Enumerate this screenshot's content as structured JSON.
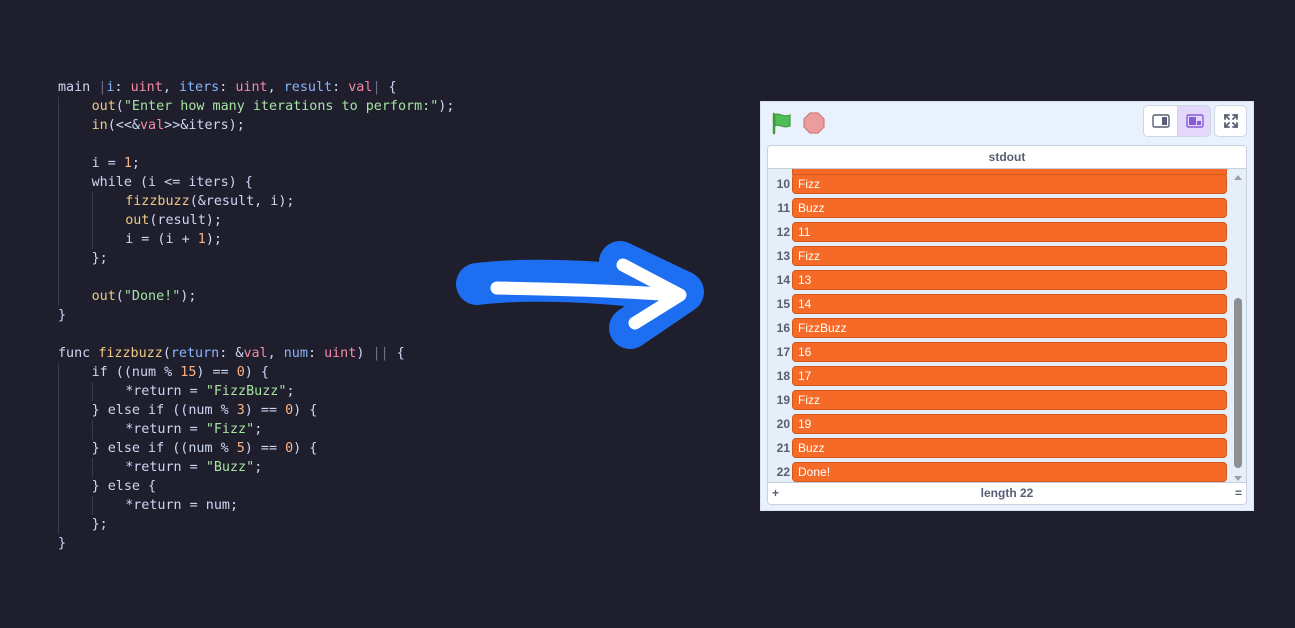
{
  "code": {
    "lines": [
      [
        {
          "t": "main ",
          "c": "kw"
        },
        {
          "t": "|",
          "c": "bar"
        },
        {
          "t": "i",
          "c": "id"
        },
        {
          "t": ": ",
          "c": "kw"
        },
        {
          "t": "uint",
          "c": "ty"
        },
        {
          "t": ", ",
          "c": "kw"
        },
        {
          "t": "iters",
          "c": "id"
        },
        {
          "t": ": ",
          "c": "kw"
        },
        {
          "t": "uint",
          "c": "ty"
        },
        {
          "t": ", ",
          "c": "kw"
        },
        {
          "t": "result",
          "c": "id"
        },
        {
          "t": ": ",
          "c": "kw"
        },
        {
          "t": "val",
          "c": "ty"
        },
        {
          "t": "|",
          "c": "bar"
        },
        {
          "t": " {",
          "c": "kw"
        }
      ],
      [
        {
          "i": 1
        },
        {
          "t": "out",
          "c": "fn"
        },
        {
          "t": "(",
          "c": "kw"
        },
        {
          "t": "\"Enter how many iterations to perform:\"",
          "c": "str"
        },
        {
          "t": ");",
          "c": "kw"
        }
      ],
      [
        {
          "i": 1
        },
        {
          "t": "in",
          "c": "fn"
        },
        {
          "t": "(<<&",
          "c": "kw"
        },
        {
          "t": "val",
          "c": "ty"
        },
        {
          "t": ">>&iters);",
          "c": "kw"
        }
      ],
      [
        {
          "i": 1
        }
      ],
      [
        {
          "i": 1
        },
        {
          "t": "i = ",
          "c": "kw"
        },
        {
          "t": "1",
          "c": "num"
        },
        {
          "t": ";",
          "c": "kw"
        }
      ],
      [
        {
          "i": 1
        },
        {
          "t": "while (i <= iters) {",
          "c": "kw"
        }
      ],
      [
        {
          "i": 2
        },
        {
          "t": "fizzbuzz",
          "c": "fn"
        },
        {
          "t": "(&result, i);",
          "c": "kw"
        }
      ],
      [
        {
          "i": 2
        },
        {
          "t": "out",
          "c": "fn"
        },
        {
          "t": "(result);",
          "c": "kw"
        }
      ],
      [
        {
          "i": 2
        },
        {
          "t": "i = (i + ",
          "c": "kw"
        },
        {
          "t": "1",
          "c": "num"
        },
        {
          "t": ");",
          "c": "kw"
        }
      ],
      [
        {
          "i": 1
        },
        {
          "t": "};",
          "c": "kw"
        }
      ],
      [
        {
          "i": 1
        }
      ],
      [
        {
          "i": 1
        },
        {
          "t": "out",
          "c": "fn"
        },
        {
          "t": "(",
          "c": "kw"
        },
        {
          "t": "\"Done!\"",
          "c": "str"
        },
        {
          "t": ");",
          "c": "kw"
        }
      ],
      [
        {
          "t": "}",
          "c": "kw"
        }
      ],
      [],
      [
        {
          "t": "func ",
          "c": "kw"
        },
        {
          "t": "fizzbuzz",
          "c": "fn"
        },
        {
          "t": "(",
          "c": "kw"
        },
        {
          "t": "return",
          "c": "id"
        },
        {
          "t": ": &",
          "c": "kw"
        },
        {
          "t": "val",
          "c": "ty"
        },
        {
          "t": ", ",
          "c": "kw"
        },
        {
          "t": "num",
          "c": "id"
        },
        {
          "t": ": ",
          "c": "kw"
        },
        {
          "t": "uint",
          "c": "ty"
        },
        {
          "t": ") ",
          "c": "kw"
        },
        {
          "t": "||",
          "c": "bar"
        },
        {
          "t": " {",
          "c": "kw"
        }
      ],
      [
        {
          "i": 1
        },
        {
          "t": "if ((num % ",
          "c": "kw"
        },
        {
          "t": "15",
          "c": "num"
        },
        {
          "t": ") == ",
          "c": "kw"
        },
        {
          "t": "0",
          "c": "num"
        },
        {
          "t": ") {",
          "c": "kw"
        }
      ],
      [
        {
          "i": 2
        },
        {
          "t": "*return = ",
          "c": "kw"
        },
        {
          "t": "\"FizzBuzz\"",
          "c": "str"
        },
        {
          "t": ";",
          "c": "kw"
        }
      ],
      [
        {
          "i": 1
        },
        {
          "t": "} else if ((num % ",
          "c": "kw"
        },
        {
          "t": "3",
          "c": "num"
        },
        {
          "t": ") == ",
          "c": "kw"
        },
        {
          "t": "0",
          "c": "num"
        },
        {
          "t": ") {",
          "c": "kw"
        }
      ],
      [
        {
          "i": 2
        },
        {
          "t": "*return = ",
          "c": "kw"
        },
        {
          "t": "\"Fizz\"",
          "c": "str"
        },
        {
          "t": ";",
          "c": "kw"
        }
      ],
      [
        {
          "i": 1
        },
        {
          "t": "} else if ((num % ",
          "c": "kw"
        },
        {
          "t": "5",
          "c": "num"
        },
        {
          "t": ") == ",
          "c": "kw"
        },
        {
          "t": "0",
          "c": "num"
        },
        {
          "t": ") {",
          "c": "kw"
        }
      ],
      [
        {
          "i": 2
        },
        {
          "t": "*return = ",
          "c": "kw"
        },
        {
          "t": "\"Buzz\"",
          "c": "str"
        },
        {
          "t": ";",
          "c": "kw"
        }
      ],
      [
        {
          "i": 1
        },
        {
          "t": "} else {",
          "c": "kw"
        }
      ],
      [
        {
          "i": 2
        },
        {
          "t": "*return = num;",
          "c": "kw"
        }
      ],
      [
        {
          "i": 1
        },
        {
          "t": "};",
          "c": "kw"
        }
      ],
      [
        {
          "t": "}",
          "c": "kw"
        }
      ]
    ]
  },
  "colors": {
    "background": "#1f1e2d",
    "arrow": "#1d6ef0",
    "list_item": "#f56a27",
    "flag": "#4cbf56",
    "stop": "#ec9c9c"
  },
  "stage": {
    "icons": [
      "green-flag-icon",
      "stop-icon",
      "small-stage-icon",
      "normal-stage-icon",
      "fullscreen-icon"
    ]
  },
  "monitor": {
    "title": "stdout",
    "items": [
      {
        "index": "10",
        "value": "Fizz"
      },
      {
        "index": "11",
        "value": "Buzz"
      },
      {
        "index": "12",
        "value": "11"
      },
      {
        "index": "13",
        "value": "Fizz"
      },
      {
        "index": "14",
        "value": "13"
      },
      {
        "index": "15",
        "value": "14"
      },
      {
        "index": "16",
        "value": "FizzBuzz"
      },
      {
        "index": "17",
        "value": "16"
      },
      {
        "index": "18",
        "value": "17"
      },
      {
        "index": "19",
        "value": "Fizz"
      },
      {
        "index": "20",
        "value": "19"
      },
      {
        "index": "21",
        "value": "Buzz"
      },
      {
        "index": "22",
        "value": "Done!"
      }
    ],
    "add_label": "+",
    "length_label": "length 22",
    "resize_label": "="
  }
}
